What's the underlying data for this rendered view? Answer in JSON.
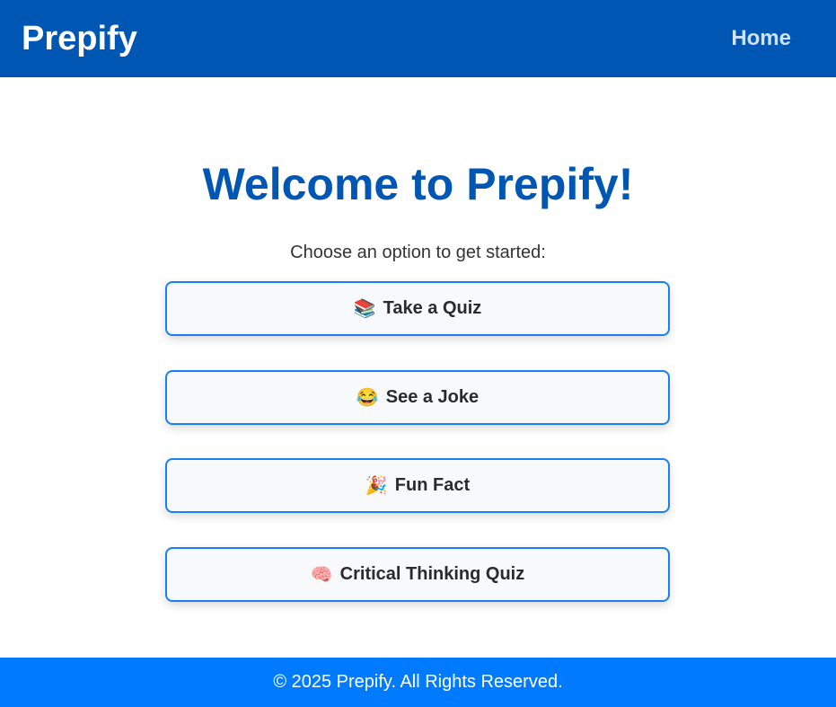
{
  "header": {
    "brand": "Prepify",
    "nav_home": "Home"
  },
  "main": {
    "title": "Welcome to Prepify!",
    "subtitle": "Choose an option to get started:",
    "options": [
      {
        "icon": "📚",
        "icon_name": "books-icon",
        "label": "Take a Quiz"
      },
      {
        "icon": "😂",
        "icon_name": "laughing-face-icon",
        "label": "See a Joke"
      },
      {
        "icon": "🎉",
        "icon_name": "party-popper-icon",
        "label": "Fun Fact"
      },
      {
        "icon": "🧠",
        "icon_name": "brain-icon",
        "label": "Critical Thinking Quiz"
      }
    ]
  },
  "footer": {
    "copyright": "© 2025 Prepify. All Rights Reserved."
  },
  "colors": {
    "header_bg": "#0056b3",
    "accent": "#007bff",
    "button_border": "#1a7ff0",
    "title": "#0056b3"
  }
}
